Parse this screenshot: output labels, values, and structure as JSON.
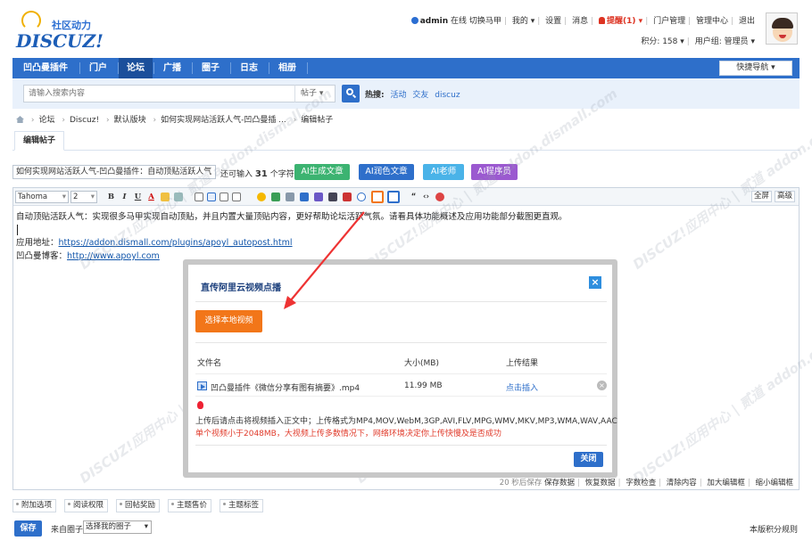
{
  "header": {
    "logo_sub": "社区动力",
    "logo_main": "DISCUZ!",
    "user": "admin",
    "online": "在线",
    "switch_vest": "切换马甲",
    "my": "我的",
    "settings": "设置",
    "messages": "消息",
    "alerts": "提醒(1)",
    "portal_manage": "门户管理",
    "admin_center": "管理中心",
    "logout": "退出",
    "credits": "积分: 158",
    "user_group": "用户组: 管理员"
  },
  "nav": {
    "items": [
      "凹凸曼插件",
      "门户",
      "论坛",
      "广播",
      "圈子",
      "日志",
      "相册"
    ],
    "active_index": 2,
    "quick_nav": "快捷导航"
  },
  "search": {
    "placeholder": "请输入搜索内容",
    "type": "帖子",
    "hot_label": "热搜:",
    "hot_words": [
      "活动",
      "交友",
      "discuz"
    ]
  },
  "breadcrumb": [
    "论坛",
    "Discuz!",
    "默认版块",
    "如何实现网站活跃人气-凹凸曼插 ...",
    "编辑帖子"
  ],
  "tab": {
    "label": "编辑帖子"
  },
  "title_bar": {
    "value": "如何实现网站活跃人气-凹凸曼插件：自动顶贴活跃人气",
    "hint_prefix": "还可输入",
    "hint_count": "31",
    "hint_suffix": "个字符",
    "ai_buttons": [
      {
        "label": "AI生成文章",
        "color": "#3cb371"
      },
      {
        "label": "AI润色文章",
        "color": "#2e6fca"
      },
      {
        "label": "AI老师",
        "color": "#4ab3e8"
      },
      {
        "label": "AI程序员",
        "color": "#9b59d0"
      }
    ]
  },
  "editor": {
    "font": "Tahoma",
    "size": "2",
    "fullscreen": "全屏",
    "advanced": "高级",
    "line1": "自动顶贴活跃人气：实现很多马甲实现自动顶贴，并且内置大量顶贴内容，更好帮助论坛活跃气氛。请看具体功能概述及应用功能部分截图更直观。",
    "line2_label": "应用地址：",
    "line2_link": "https://addon.dismall.com/plugins/apoyl_autopost.html",
    "line3_label": "凹凸曼博客：",
    "line3_link": "http://www.apoyl.com",
    "status": {
      "autosave": "20 秒后保存",
      "save_data": "保存数据",
      "restore_data": "恢复数据",
      "word_check": "字数检查",
      "clear": "清除内容",
      "enlarge": "加大编辑框",
      "shrink": "缩小编辑框"
    }
  },
  "watermark": "DISCUZ!应用中心 | 贰道 addon.dismall.com",
  "dialog": {
    "title": "直传阿里云视频点播",
    "upload_button": "选择本地视频",
    "col_file": "文件名",
    "col_size": "大小(MB)",
    "col_result": "上传结果",
    "file_name": "凹凸曼插件《微信分享有图有摘要》.mp4",
    "file_size": "11.99 MB",
    "file_action": "点击插入",
    "note1": "上传后请点击将视频插入正文中；上传格式为MP4,MOV,WebM,3GP,AVI,FLV,MPG,WMV,MKV,MP3,WMA,WAV,AAC",
    "note2": "单个视频小于2048MB，大视频上传多数情况下，网络环境决定你上传快慢及是否成功",
    "close_button": "关闭"
  },
  "bottom": {
    "options": [
      "附加选项",
      "阅读权限",
      "回帖奖励",
      "主题售价",
      "主题标签"
    ],
    "save": "保存",
    "circle_label": "来自圈子:",
    "circle_select": "选择我的圈子",
    "rules": "本版积分规则"
  }
}
